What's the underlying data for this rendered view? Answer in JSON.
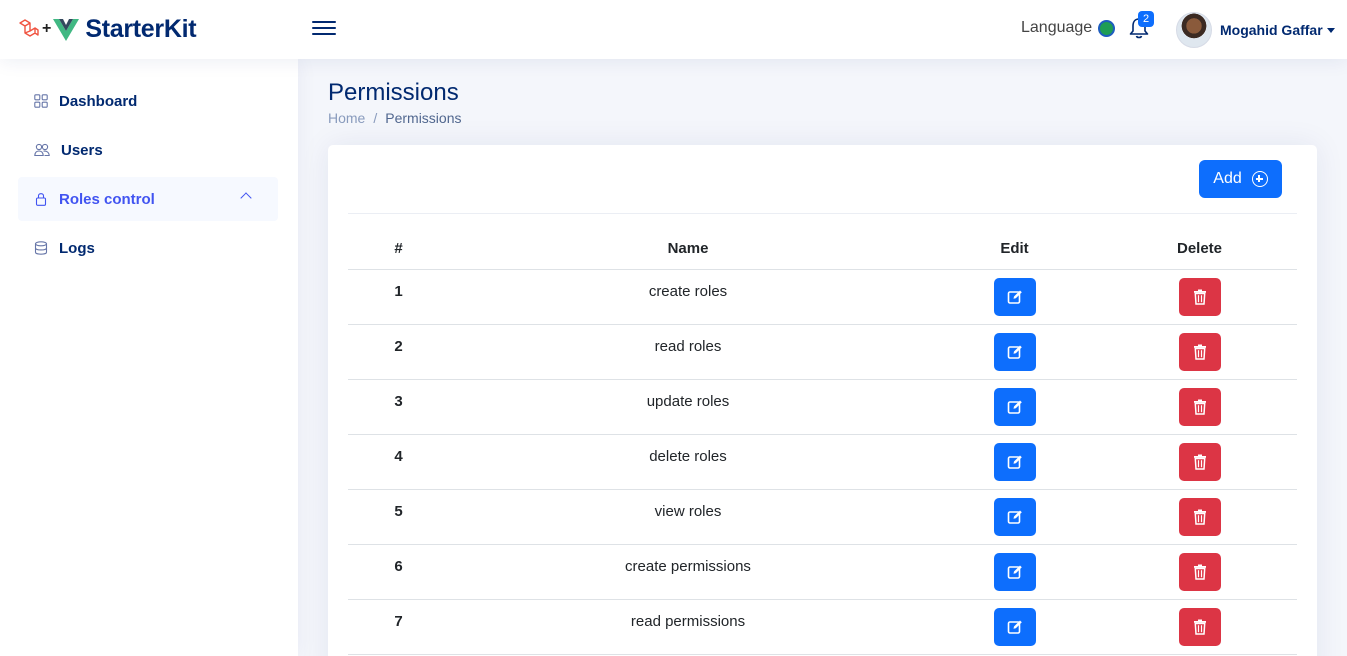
{
  "header": {
    "brand": "StarterKit",
    "logo_plus": "+",
    "language_label": "Language",
    "notifications_count": "2",
    "user_name": "Mogahid Gaffar"
  },
  "sidebar": {
    "items": [
      {
        "label": "Dashboard",
        "icon": "grid-icon",
        "active": false
      },
      {
        "label": "Users",
        "icon": "people-icon",
        "active": false
      },
      {
        "label": "Roles control",
        "icon": "lock-icon",
        "active": true
      },
      {
        "label": "Logs",
        "icon": "database-icon",
        "active": false
      }
    ]
  },
  "page": {
    "title": "Permissions",
    "breadcrumb": {
      "home": "Home",
      "separator": "/",
      "current": "Permissions"
    }
  },
  "toolbar": {
    "add_label": "Add"
  },
  "table": {
    "headers": {
      "num": "#",
      "name": "Name",
      "edit": "Edit",
      "delete": "Delete"
    },
    "rows": [
      {
        "num": "1",
        "name": "create roles"
      },
      {
        "num": "2",
        "name": "read roles"
      },
      {
        "num": "3",
        "name": "update roles"
      },
      {
        "num": "4",
        "name": "delete roles"
      },
      {
        "num": "5",
        "name": "view roles"
      },
      {
        "num": "6",
        "name": "create permissions"
      },
      {
        "num": "7",
        "name": "read permissions"
      }
    ]
  },
  "colors": {
    "primary": "#0d6efd",
    "danger": "#dc3545",
    "navy": "#012970",
    "accent": "#4154f1"
  }
}
